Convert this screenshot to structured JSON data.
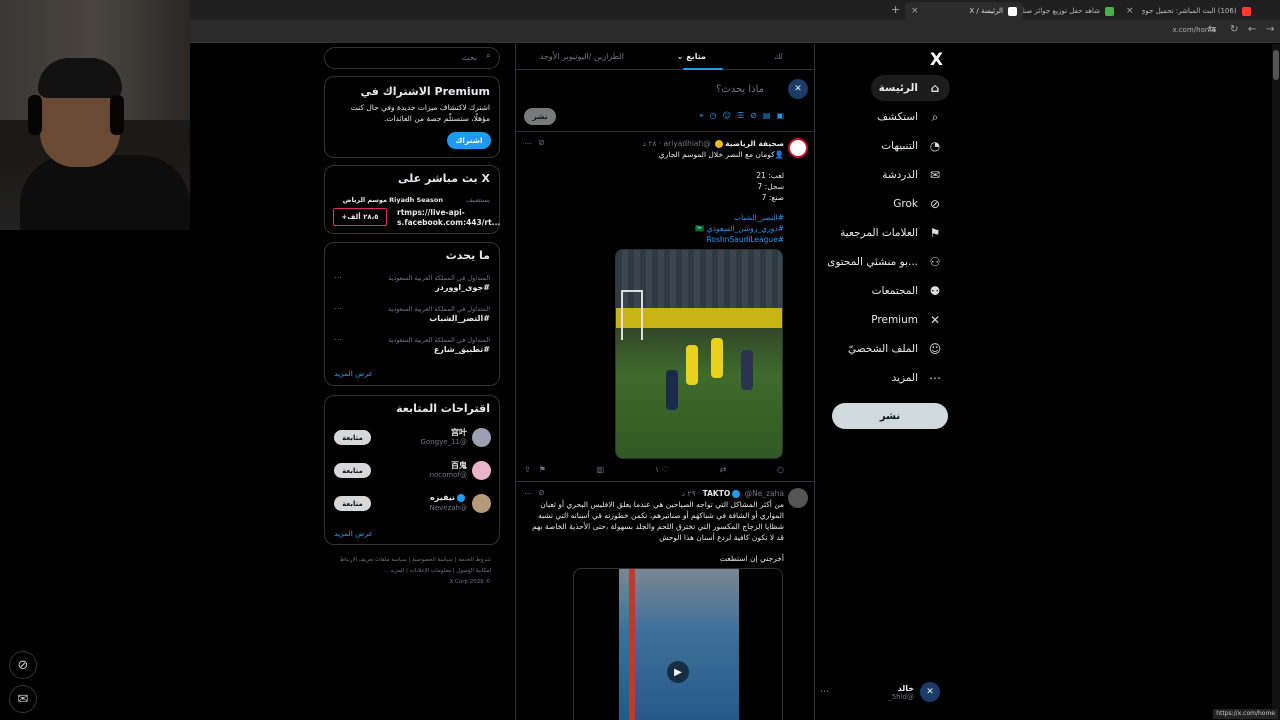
{
  "browser": {
    "tabs": [
      {
        "label": "(106) البث المباشر: تحميل جوي ايو",
        "color": "#ff3b30"
      },
      {
        "label": "شاهد حفل توزيع جوائز صناع الترف",
        "color": "#4caf50"
      },
      {
        "label": "الرئيسة / X",
        "color": "#ffffff"
      }
    ],
    "url": "x.com/home",
    "status_url": "https://x.com/home"
  },
  "nav": {
    "logo": "X",
    "items": [
      {
        "label": "الرئيسة",
        "icon": "home-icon",
        "glyph": "⌂",
        "active": true
      },
      {
        "label": "استكشف",
        "icon": "search-icon",
        "glyph": "⌕",
        "active": false
      },
      {
        "label": "التنبيهات",
        "icon": "bell-icon",
        "glyph": "◔",
        "active": false
      },
      {
        "label": "الدردشة",
        "icon": "mail-icon",
        "glyph": "✉",
        "active": false
      },
      {
        "label": "Grok",
        "icon": "grok-icon",
        "glyph": "⊘",
        "active": false
      },
      {
        "label": "العلامات المرجعية",
        "icon": "bookmark-icon",
        "glyph": "⚑",
        "active": false
      },
      {
        "label": "...بو منشئي المحتوى",
        "icon": "creator-icon",
        "glyph": "⚇",
        "active": false
      },
      {
        "label": "المجتمعات",
        "icon": "communities-icon",
        "glyph": "⚉",
        "active": false
      },
      {
        "label": "Premium",
        "icon": "x-icon",
        "glyph": "✕",
        "active": false
      },
      {
        "label": "الملف الشخصيّ",
        "icon": "profile-icon",
        "glyph": "☺",
        "active": false
      },
      {
        "label": "المزيد",
        "icon": "more-icon",
        "glyph": "⋯",
        "active": false
      }
    ],
    "post_button": "نشر",
    "profile": {
      "name": "خالد",
      "handle": "@5hld_"
    }
  },
  "main": {
    "tabs": [
      "لك",
      "متابع",
      "الطرازين /اليوتيوبر الأوحد"
    ],
    "composer": {
      "placeholder": "ماذا يحدث؟",
      "post_button": "نشر"
    },
    "tweets": [
      {
        "author": "صحيفة الرياضية",
        "handle": "@ariyadhiah",
        "time": "٢٨ د",
        "line1": "👤كومان مع النصر خلال الموسم الجاري",
        "stats": [
          "لعب: 21",
          "سجل: 7",
          "صنع: 7"
        ],
        "hashtags": [
          "#النصر_الشباب",
          "#دوري_روشن_السعودي 🇸🇦",
          "#RoshnSaudiLeague"
        ],
        "likes": "١"
      },
      {
        "author": "TAKTO",
        "handle": "@Ne_zaha",
        "time": "٢٩ د",
        "lines": [
          "من أكثر المشاكل التي تواجه الصياحين هي عندما يعلق الافليس البحري أو ثعبان",
          "المواري أو الشافة في شباكهم أو صنانيرهم، تكمن خطورته في أسنانه التي تشبه",
          "شظايا الزجاج المكسور التي تخترق اللحم والجلد بسهولة ،حتى الأحذية الخاصة بهم",
          "قد لا تكون كافية لردع أسنان هذا الوحش"
        ],
        "footer_line": "أخرجني إن استطعت"
      }
    ]
  },
  "side": {
    "search_placeholder": "بحث",
    "premium": {
      "title": "Premium الاشتراك في",
      "text1": "اشترك لاكتشاف ميزات جديدة وفي حال كنت",
      "text2": "مؤهلًا، ستستلّم حصة من العائدات.",
      "button": "اشتراك"
    },
    "live": {
      "title": "X بث مباشر على",
      "host": "Riyadh Season",
      "host_label": "يستضيف",
      "event": "موسم الرياض",
      "link1": "rtmps://live-api-",
      "link2": "s.facebook.com:443/rt...",
      "viewers": "٢٨،٥ ألف+"
    },
    "trends": {
      "title": "ما يحدث",
      "items": [
        {
          "context": "المتداول في المملكة العربية السعودية",
          "tag": "#جوى_اووردز"
        },
        {
          "context": "المتداول في المملكة العربية السعودية",
          "tag": "#النصر_الشباب"
        },
        {
          "context": "المتداول في المملكة العربية السعودية",
          "tag": "#تطبيق_شارع"
        }
      ],
      "show_more": "عرض المزيد"
    },
    "follow": {
      "title": "اقتراحات المتابعة",
      "items": [
        {
          "name": "宫叶",
          "handle": "@Gongye_11",
          "button": "متابعة",
          "color": "#9aa0b0"
        },
        {
          "name": "百鬼",
          "handle": "@nocomof",
          "button": "متابعة",
          "color": "#e9b3c9"
        },
        {
          "name": "نيفيزه",
          "handle": "@Nevezah",
          "button": "متابعة",
          "color": "#b59a7a"
        }
      ],
      "show_more": "عرض المزيد"
    },
    "footer": {
      "line1": "شروط الخدمة | سياسة الخصوصية | سياسة ملفات تعريف الارتباط",
      "line2": "إمكانية الوصول | معلومات الإعلانات | المزيد ...",
      "line3": "© 2026 X Corp."
    }
  }
}
